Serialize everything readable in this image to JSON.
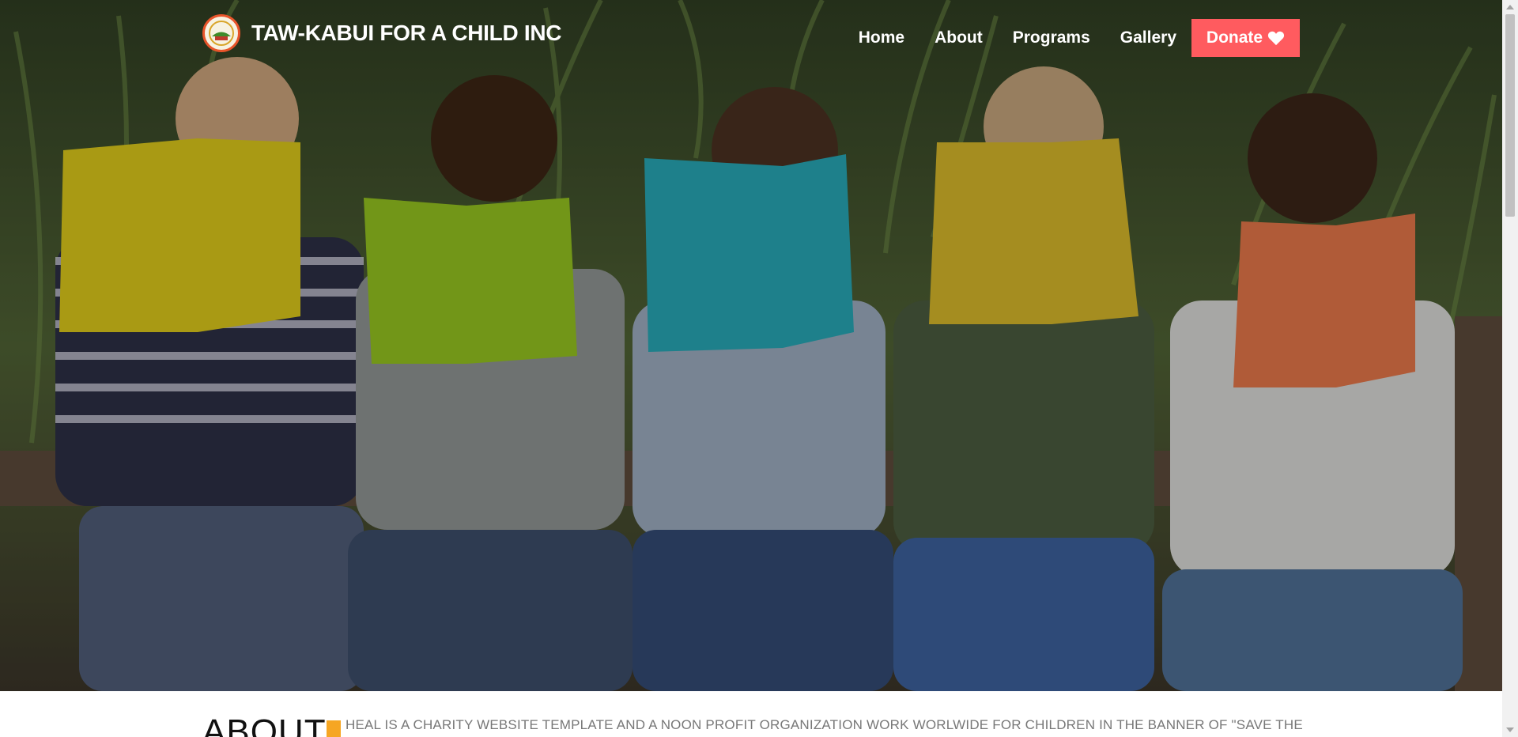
{
  "brand": {
    "name": "TAW-KABUI FOR A CHILD INC",
    "logo_icon": "organization-logo-icon"
  },
  "nav": {
    "items": [
      {
        "label": "Home"
      },
      {
        "label": "About"
      },
      {
        "label": "Programs"
      },
      {
        "label": "Gallery"
      }
    ],
    "donate_label": "Donate",
    "donate_icon": "heart-icon",
    "donate_color": "#ff5b5f"
  },
  "hero": {
    "image": "children-reading-books-photo"
  },
  "about": {
    "title": "ABOUT",
    "accent_color": "#f6a623",
    "text": "HEAL IS A CHARITY WEBSITE TEMPLATE AND A NOON PROFIT ORGANIZATION WORK WORLWIDE FOR CHILDREN IN THE BANNER OF \"SAVE THE"
  }
}
